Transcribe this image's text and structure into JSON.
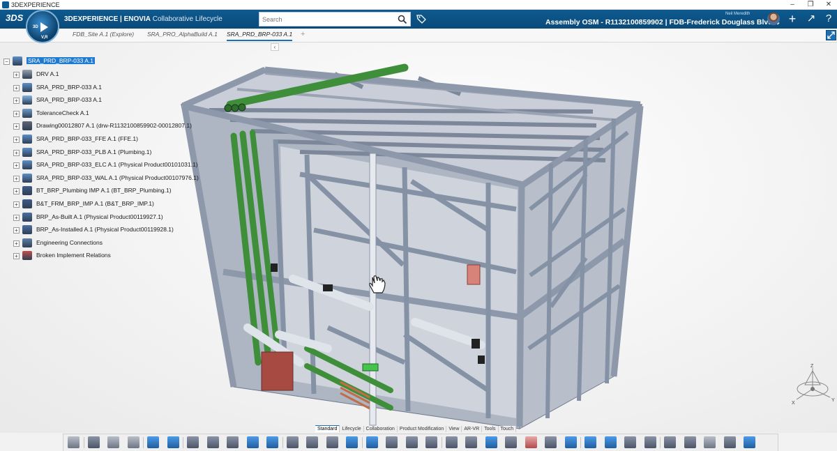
{
  "window": {
    "title": "3DEXPERIENCE",
    "minimize": "–",
    "restore": "❐",
    "close": "✕"
  },
  "topbar": {
    "ds_logo": "3DS",
    "brand_main": "3DEXPERIENCE | ENOVIA",
    "brand_app": "Collaborative Lifecycle",
    "search_placeholder": "Search",
    "user_name": "Neil Meredith",
    "context": "Assembly OSM - R1132100859902 | FDB-Frederick Douglass Blvd",
    "context_chevron": "⌄",
    "add": "+",
    "share": "↗",
    "help": "?"
  },
  "compass": {
    "top": "3D",
    "bottom": "V,R"
  },
  "tabs": [
    {
      "label": "FDB_Site A.1 (Explore)"
    },
    {
      "label": "SRA_PRO_AlphaBuild A.1"
    },
    {
      "label": "SRA_PRD_BRP-033 A.1"
    }
  ],
  "tab_add": "+",
  "collapse_panel": "‹",
  "tree": {
    "root": "SRA_PRD_BRP-033 A.1",
    "items": [
      {
        "label": "DRV A.1",
        "icon": "part-icon"
      },
      {
        "label": "SRA_PRD_BRP-033 A.1",
        "icon": "product-icon"
      },
      {
        "label": "SRA_PRD_BRP-033 A.1",
        "icon": "tube-icon"
      },
      {
        "label": "ToleranceCheck A.1",
        "icon": "check-icon"
      },
      {
        "label": "Drawing00012807 A.1 (drw-R1132100859902-00012807.1)",
        "icon": "drawing-icon"
      },
      {
        "label": "SRA_PRD_BRP-033_FFE A.1 (FFE.1)",
        "icon": "product-icon"
      },
      {
        "label": "SRA_PRD_BRP-033_PLB A.1 (Plumbing.1)",
        "icon": "product-icon"
      },
      {
        "label": "SRA_PRD_BRP-033_ELC A.1 (Physical Product00101031.1)",
        "icon": "product-icon"
      },
      {
        "label": "SRA_PRD_BRP-033_WAL A.1 (Physical Product00107976.1)",
        "icon": "product-icon"
      },
      {
        "label": "BT_BRP_Plumbing IMP A.1 (BT_BRP_Plumbing.1)",
        "icon": "implement-icon"
      },
      {
        "label": "B&T_FRM_BRP_IMP A.1 (B&T_BRP_IMP.1)",
        "icon": "implement-icon"
      },
      {
        "label": "BRP_As-Built A.1 (Physical Product00119927.1)",
        "icon": "physical-product-icon"
      },
      {
        "label": "BRP_As-Installed A.1 (Physical Product00119928.1)",
        "icon": "physical-product-icon"
      },
      {
        "label": "Engineering Connections",
        "icon": "connections-icon"
      },
      {
        "label": "Broken Implement Relations",
        "icon": "broken-relations-icon"
      }
    ]
  },
  "triad": {
    "z": "Z",
    "x": "X",
    "y": "Y"
  },
  "toolbar_tabs": [
    "Standard",
    "Lifecycle",
    "Collaboration",
    "Product Modification",
    "View",
    "AR-VR",
    "Tools",
    "Touch"
  ],
  "toolbar_active_tab": "Standard",
  "colors": {
    "accent": "#0e5a8f",
    "selection": "#1f7ad1",
    "frame": "#8d98ab",
    "pipe_green": "#3f8f3a"
  }
}
